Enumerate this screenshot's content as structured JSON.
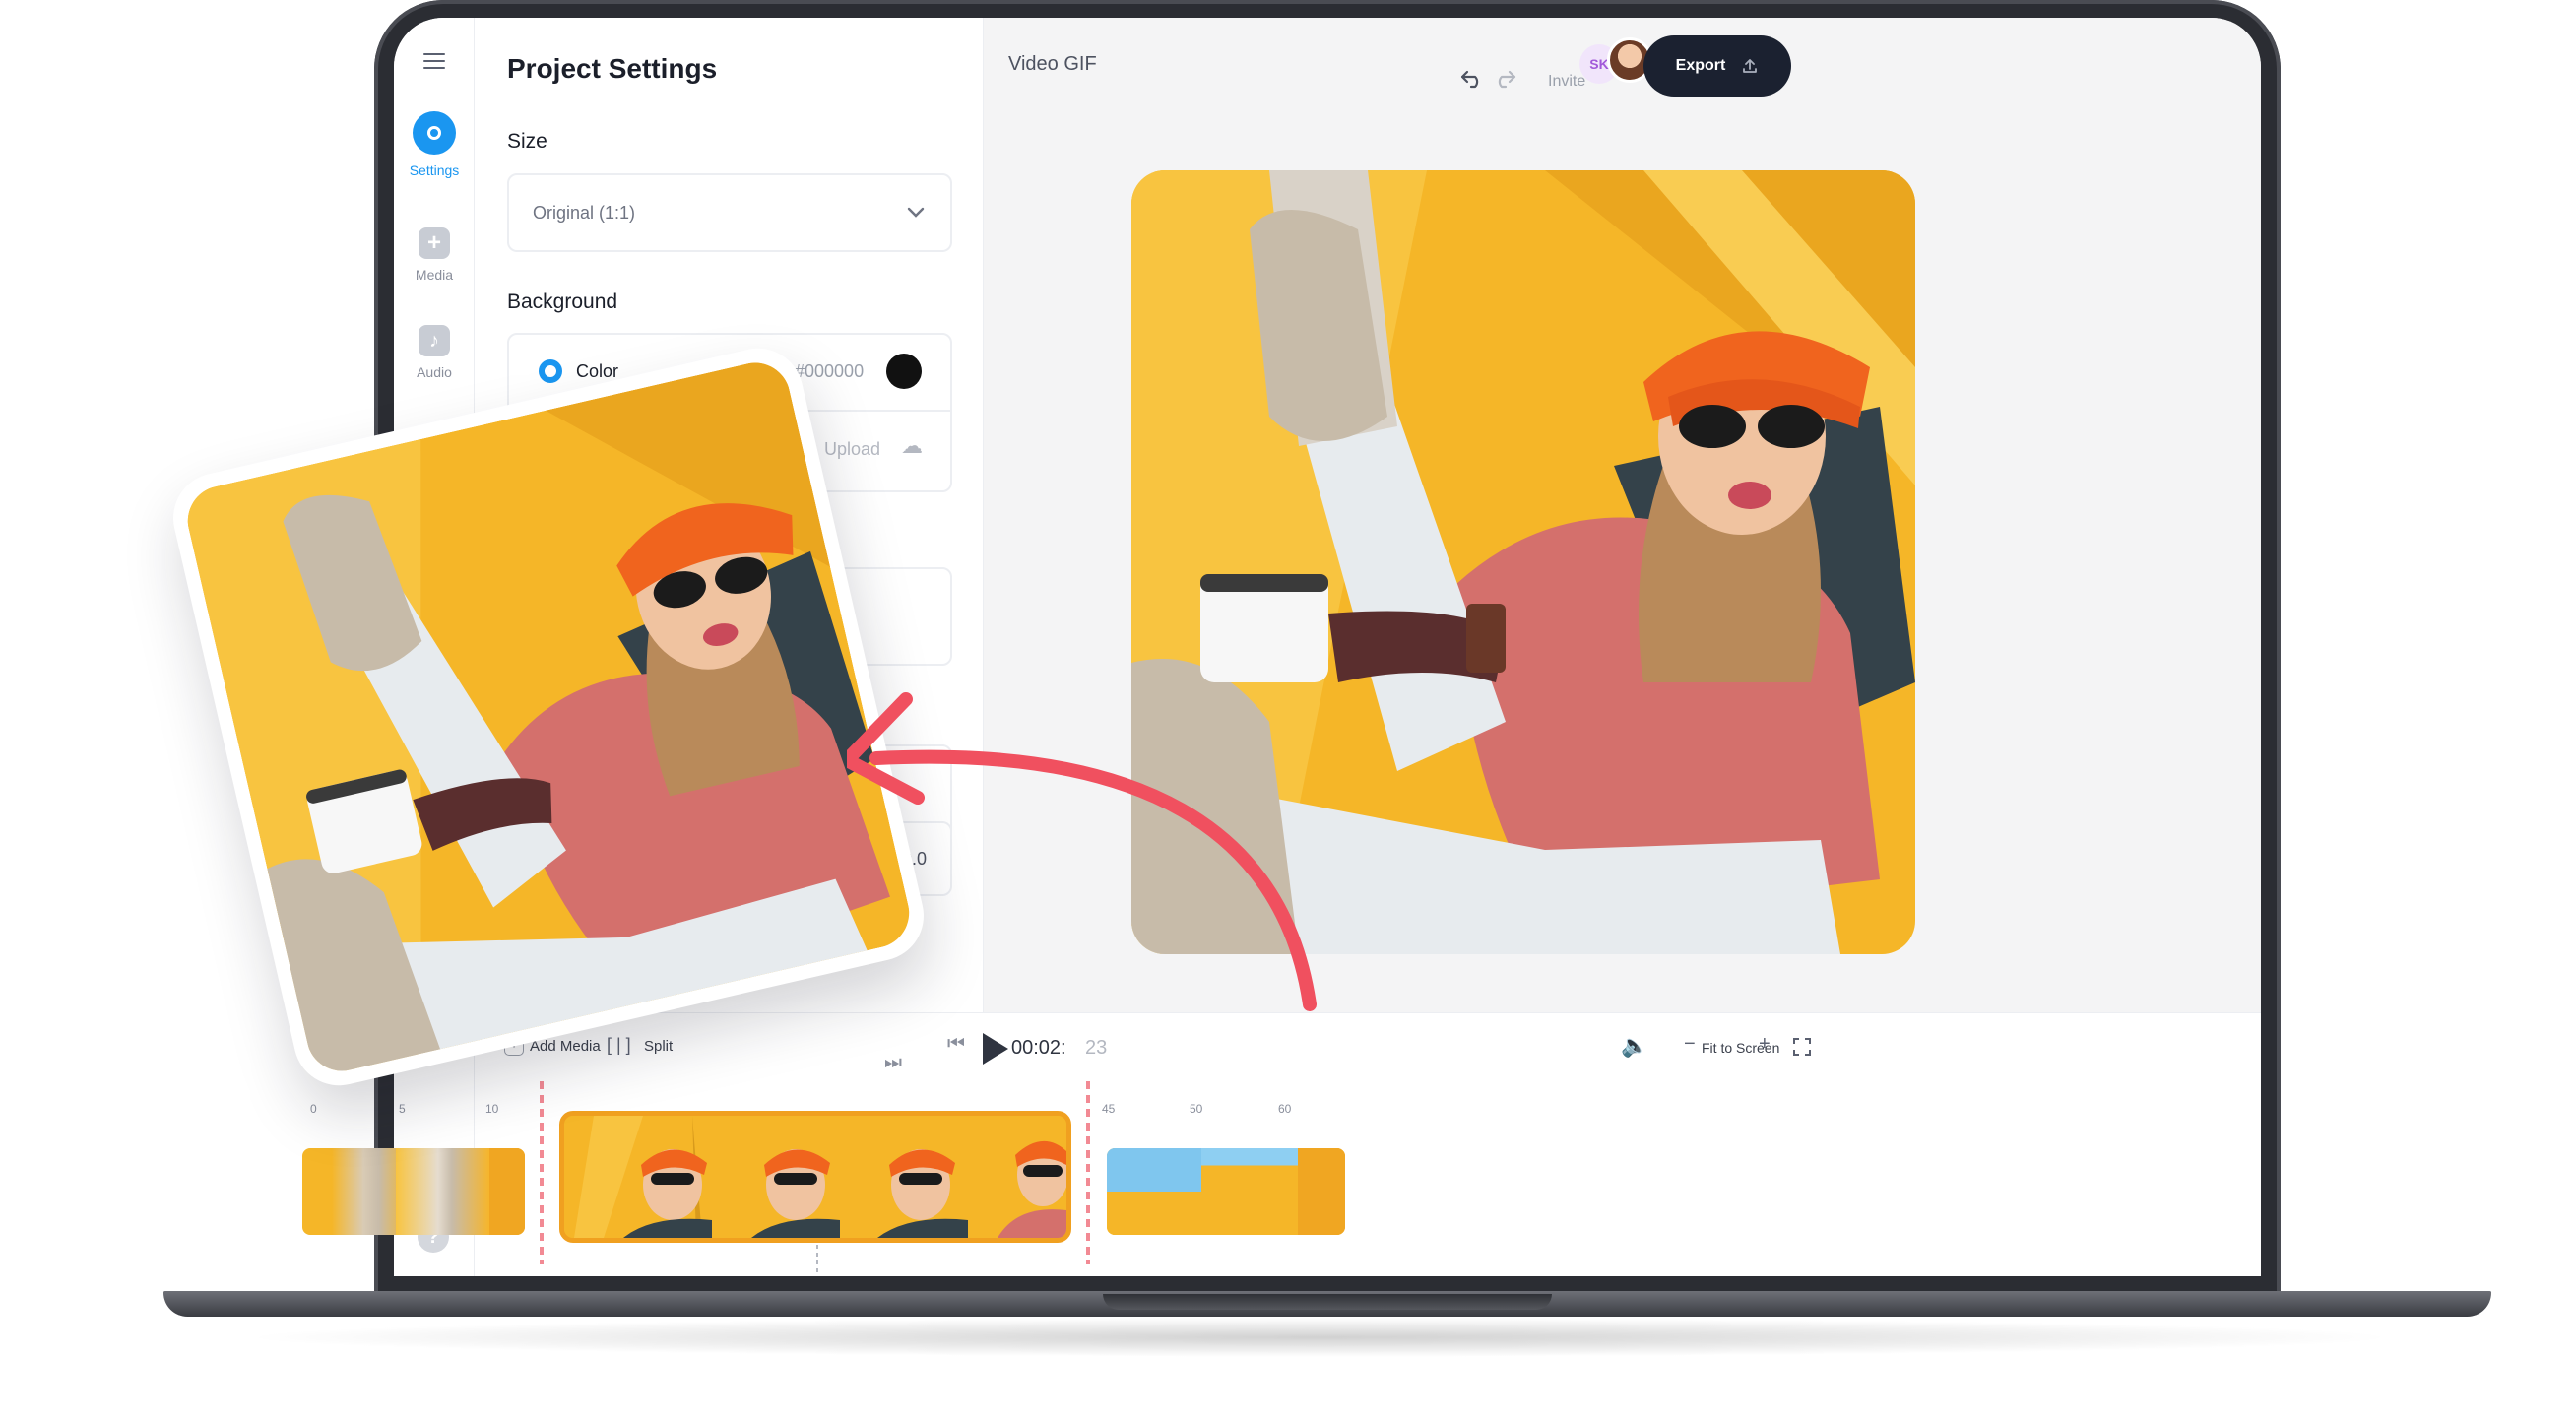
{
  "rail": {
    "items": [
      {
        "label": "Settings",
        "icon": "settings-icon"
      },
      {
        "label": "Media",
        "icon": "plus-icon"
      },
      {
        "label": "Audio",
        "icon": "music-note-icon"
      }
    ],
    "help_label": "?"
  },
  "panel": {
    "title": "Project Settings",
    "size_label": "Size",
    "size_value": "Original (1:1)",
    "background_label": "Background",
    "color_label": "Color",
    "color_value": "#000000",
    "upload_label": "Upload",
    "duration_value": "01:00.0"
  },
  "header": {
    "document_title": "Video GIF",
    "invite_label": "Invite",
    "collaborator_initials": "SK",
    "export_label": "Export"
  },
  "timeline": {
    "add_media_label": "Add Media",
    "split_label": "Split",
    "time_current": "00:02:",
    "time_frames": "23",
    "fit_label": "Fit to Screen",
    "ruler_left": [
      "0",
      "5",
      "10"
    ],
    "ruler_right": [
      "45",
      "50",
      "60"
    ]
  },
  "colors": {
    "accent": "#1a96f0",
    "export_bg": "#1b2130",
    "clip_border": "#f0a020",
    "arrow": "#f0505f",
    "tent_yellow": "#f5b628"
  }
}
